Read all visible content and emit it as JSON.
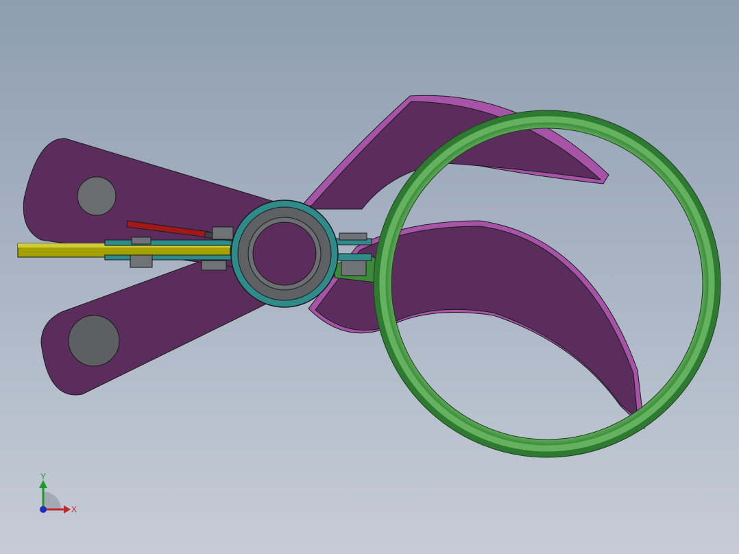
{
  "viewport": {
    "background_top": "#8e9db0",
    "background_bottom": "#c6ccd6"
  },
  "colors": {
    "jaw_purple": "#5a2d5c",
    "jaw_edge": "#a653a8",
    "ring_green": "#3d8a3d",
    "ring_green_light": "#5fae5a",
    "hub_teal": "#2f8a8a",
    "hub_gray": "#5e6064",
    "arm_yellow": "#a3a000",
    "link_red": "#a01818",
    "pin_gray": "#5a5c60"
  },
  "triad": {
    "x_label": "X",
    "y_label": "Y",
    "x_color": "#c0282b",
    "y_color": "#1f9a2a",
    "z_color": "#1c2fb8"
  }
}
